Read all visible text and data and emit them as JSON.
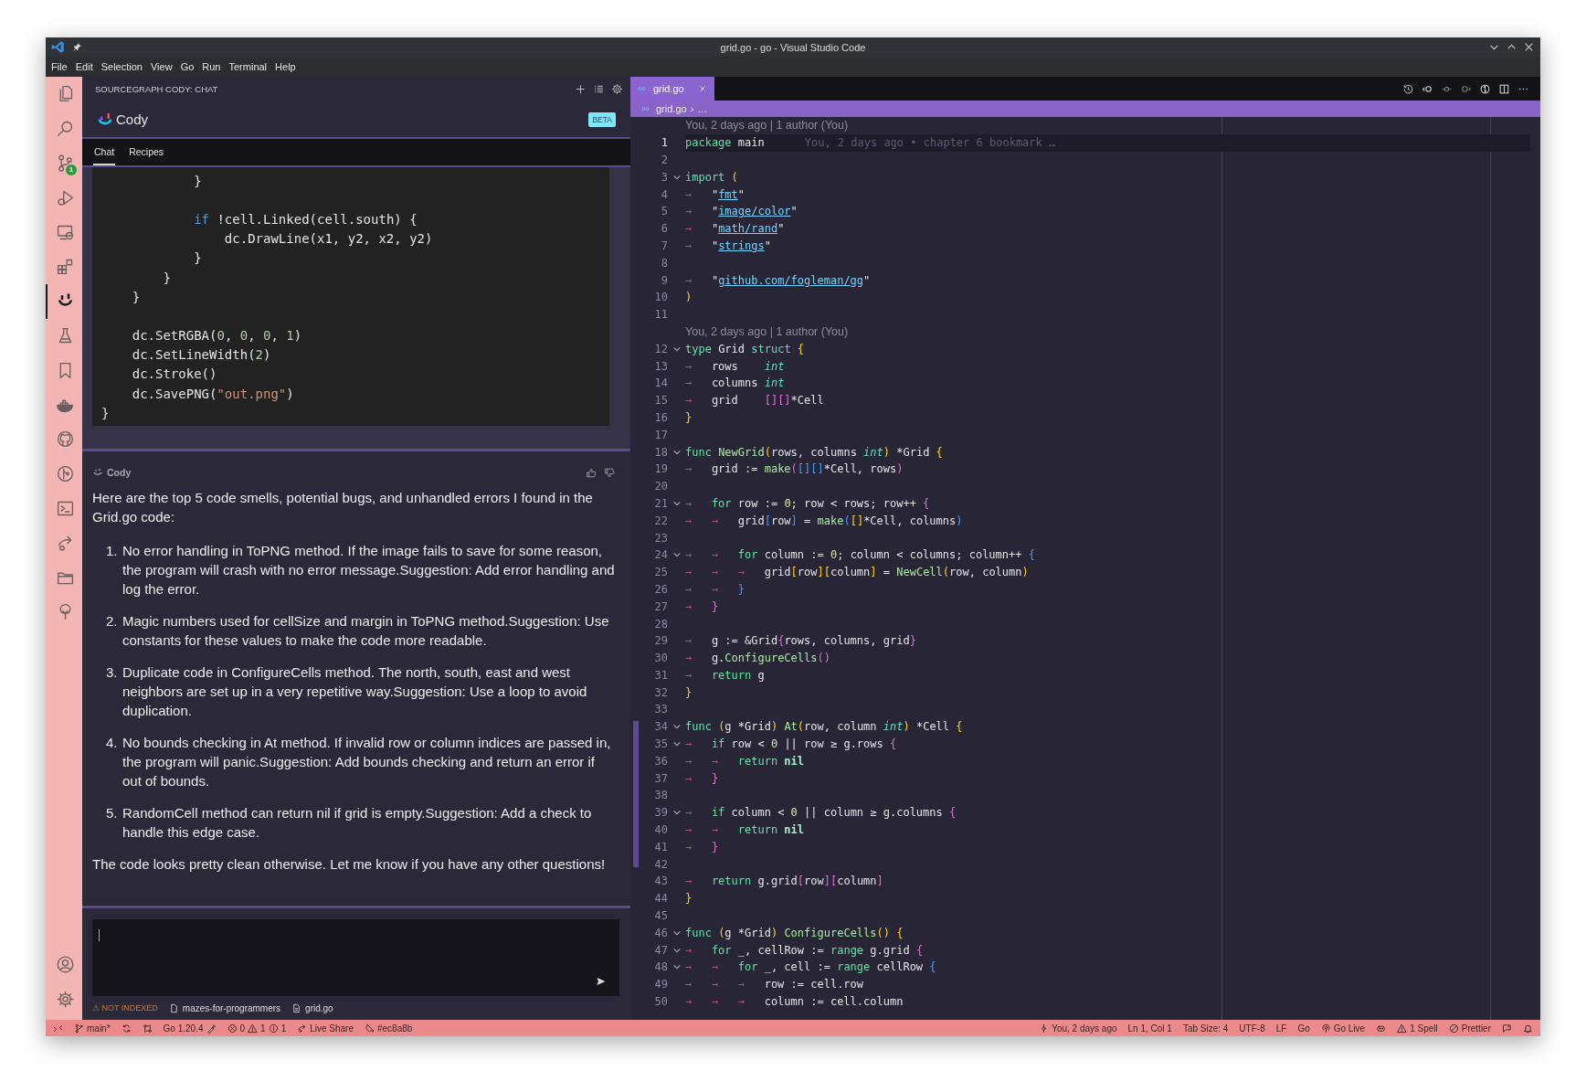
{
  "window": {
    "title": "grid.go - go - Visual Studio Code"
  },
  "menu": [
    "File",
    "Edit",
    "Selection",
    "View",
    "Go",
    "Run",
    "Terminal",
    "Help"
  ],
  "activity_bar": {
    "items": [
      {
        "kind": "files",
        "selected": false
      },
      {
        "kind": "search",
        "selected": false
      },
      {
        "kind": "source-control",
        "selected": false,
        "badge": "1"
      },
      {
        "kind": "run-debug",
        "selected": false
      },
      {
        "kind": "remote",
        "selected": false
      },
      {
        "kind": "extensions",
        "selected": false
      },
      {
        "kind": "cody",
        "selected": true
      },
      {
        "kind": "testing",
        "selected": false
      },
      {
        "kind": "bookmarks",
        "selected": false
      },
      {
        "kind": "docker",
        "selected": false
      },
      {
        "kind": "github",
        "selected": false
      },
      {
        "kind": "git-graph",
        "selected": false
      },
      {
        "kind": "terminal",
        "selected": false
      },
      {
        "kind": "live-share",
        "selected": false
      },
      {
        "kind": "folder",
        "selected": false
      },
      {
        "kind": "tree",
        "selected": false
      }
    ],
    "bottom": [
      {
        "kind": "account",
        "selected": false
      },
      {
        "kind": "settings",
        "selected": false
      }
    ]
  },
  "chat_panel": {
    "header": "SOURCEGRAPH CODY: CHAT",
    "title": "Cody",
    "badge": "BETA",
    "tabs": [
      {
        "label": "Chat",
        "selected": true
      },
      {
        "label": "Recipes",
        "selected": false
      }
    ],
    "code_block": [
      {
        "kind": "code",
        "tokens": [
          {
            "kind": "pl",
            "text": "            }"
          }
        ]
      },
      {
        "kind": "blank"
      },
      {
        "kind": "code",
        "tokens": [
          {
            "kind": "kw",
            "text": "            if"
          },
          {
            "kind": "pl",
            "text": " !cell.Linked(cell.south) {"
          }
        ]
      },
      {
        "kind": "code",
        "tokens": [
          {
            "kind": "pl",
            "text": "                dc.DrawLine(x1, y2, x2, y2)"
          }
        ]
      },
      {
        "kind": "code",
        "tokens": [
          {
            "kind": "pl",
            "text": "            }"
          }
        ]
      },
      {
        "kind": "code",
        "tokens": [
          {
            "kind": "pl",
            "text": "        }"
          }
        ]
      },
      {
        "kind": "code",
        "tokens": [
          {
            "kind": "pl",
            "text": "    }"
          }
        ]
      },
      {
        "kind": "blank"
      },
      {
        "kind": "code",
        "tokens": [
          {
            "kind": "pl",
            "text": "    dc.SetRGBA("
          },
          {
            "kind": "num",
            "text": "0"
          },
          {
            "kind": "pl",
            "text": ", "
          },
          {
            "kind": "num",
            "text": "0"
          },
          {
            "kind": "pl",
            "text": ", "
          },
          {
            "kind": "num",
            "text": "0"
          },
          {
            "kind": "pl",
            "text": ", "
          },
          {
            "kind": "num",
            "text": "1"
          },
          {
            "kind": "pl",
            "text": ")"
          }
        ]
      },
      {
        "kind": "code",
        "tokens": [
          {
            "kind": "pl",
            "text": "    dc.SetLineWidth("
          },
          {
            "kind": "num",
            "text": "2"
          },
          {
            "kind": "pl",
            "text": ")"
          }
        ]
      },
      {
        "kind": "code",
        "tokens": [
          {
            "kind": "pl",
            "text": "    dc.Stroke()"
          }
        ]
      },
      {
        "kind": "code",
        "tokens": [
          {
            "kind": "pl",
            "text": "    dc.SavePNG("
          },
          {
            "kind": "str",
            "text": "\"out.png\""
          },
          {
            "kind": "pl",
            "text": ")"
          }
        ]
      },
      {
        "kind": "code",
        "tokens": [
          {
            "kind": "pl",
            "text": "}"
          }
        ]
      }
    ],
    "message": {
      "author": "Cody",
      "intro": "Here are the top 5 code smells, potential bugs, and unhandled errors I found in the Grid.go code:",
      "items": [
        {
          "number": "1.",
          "text": "No error handling in ToPNG method. If the image fails to save for some reason, the program will crash with no error message.Suggestion: Add error handling and log the error."
        },
        {
          "number": "2.",
          "text": "Magic numbers used for cellSize and margin in ToPNG method.Suggestion: Use constants for these values to make the code more readable."
        },
        {
          "number": "3.",
          "text": "Duplicate code in ConfigureCells method. The north, south, east and west neighbors are set up in a very repetitive way.Suggestion: Use a loop to avoid duplication."
        },
        {
          "number": "4.",
          "text": "No bounds checking in At method. If invalid row or column indices are passed in, the program will panic.Suggestion: Add bounds checking and return an error if out of bounds."
        },
        {
          "number": "5.",
          "text": "RandomCell method can return nil if grid is empty.Suggestion: Add a check to handle this edge case."
        }
      ],
      "closing": "The code looks pretty clean otherwise. Let me know if you have any other questions!"
    },
    "footer": {
      "warning": "⚠ NOT INDEXED",
      "repo": "mazes-for-programmers",
      "file": "grid.go"
    }
  },
  "editor": {
    "tab": {
      "label": "grid.go",
      "selected": true
    },
    "breadcrumb": [
      "grid.go",
      "›",
      "…"
    ],
    "lines": [
      {
        "kind": "lens",
        "text": "You, 2 days ago | 1 author (You)"
      },
      {
        "kind": "code",
        "number": "1",
        "fold": false,
        "current": true,
        "tokens": [
          {
            "kind": "kw",
            "text": "package"
          },
          {
            "kind": "pl",
            "text": " main"
          }
        ],
        "blame": "You, 2 days ago • chapter 6 bookmark …"
      },
      {
        "kind": "code",
        "number": "2",
        "fold": false,
        "current": false
      },
      {
        "kind": "code",
        "number": "3",
        "fold": true,
        "current": false,
        "tokens": [
          {
            "kind": "kw",
            "text": "import"
          },
          {
            "kind": "b1",
            "text": " ("
          }
        ]
      },
      {
        "kind": "code",
        "number": "4",
        "fold": false,
        "current": false,
        "tokens": [
          {
            "kind": "tab",
            "text": "→"
          },
          {
            "kind": "q",
            "text": "\""
          },
          {
            "kind": "str",
            "text": "fmt"
          },
          {
            "kind": "q",
            "text": "\""
          }
        ]
      },
      {
        "kind": "code",
        "number": "5",
        "fold": false,
        "current": false,
        "tokens": [
          {
            "kind": "tab",
            "text": "→"
          },
          {
            "kind": "q",
            "text": "\""
          },
          {
            "kind": "str",
            "text": "image/color"
          },
          {
            "kind": "q",
            "text": "\""
          }
        ]
      },
      {
        "kind": "code",
        "number": "6",
        "fold": false,
        "current": false,
        "tokens": [
          {
            "kind": "tab",
            "text": "→"
          },
          {
            "kind": "q",
            "text": "\""
          },
          {
            "kind": "str",
            "text": "math/rand"
          },
          {
            "kind": "q",
            "text": "\""
          }
        ]
      },
      {
        "kind": "code",
        "number": "7",
        "fold": false,
        "current": false,
        "tokens": [
          {
            "kind": "tab",
            "text": "→"
          },
          {
            "kind": "q",
            "text": "\""
          },
          {
            "kind": "str",
            "text": "strings"
          },
          {
            "kind": "q",
            "text": "\""
          }
        ]
      },
      {
        "kind": "code",
        "number": "8",
        "fold": false,
        "current": false
      },
      {
        "kind": "code",
        "number": "9",
        "fold": false,
        "current": false,
        "tokens": [
          {
            "kind": "tab",
            "text": "→"
          },
          {
            "kind": "q",
            "text": "\""
          },
          {
            "kind": "str",
            "text": "github.com/fogleman/gg"
          },
          {
            "kind": "q",
            "text": "\""
          }
        ]
      },
      {
        "kind": "code",
        "number": "10",
        "fold": false,
        "current": false,
        "tokens": [
          {
            "kind": "b1",
            "text": ")"
          }
        ]
      },
      {
        "kind": "code",
        "number": "11",
        "fold": false,
        "current": false
      },
      {
        "kind": "lens",
        "text": "You, 2 days ago | 1 author (You)"
      },
      {
        "kind": "code",
        "number": "12",
        "fold": true,
        "current": false,
        "tokens": [
          {
            "kind": "kw",
            "text": "type"
          },
          {
            "kind": "pl",
            "text": " Grid "
          },
          {
            "kind": "kw",
            "text": "struct"
          },
          {
            "kind": "b1",
            "text": " {"
          }
        ]
      },
      {
        "kind": "code",
        "number": "13",
        "fold": false,
        "current": false,
        "tokens": [
          {
            "kind": "tab",
            "text": "→"
          },
          {
            "kind": "pl",
            "text": "rows    "
          },
          {
            "kind": "ty",
            "text": "int"
          }
        ]
      },
      {
        "kind": "code",
        "number": "14",
        "fold": false,
        "current": false,
        "tokens": [
          {
            "kind": "tab",
            "text": "→"
          },
          {
            "kind": "pl",
            "text": "columns "
          },
          {
            "kind": "ty",
            "text": "int"
          }
        ]
      },
      {
        "kind": "code",
        "number": "15",
        "fold": false,
        "current": false,
        "tokens": [
          {
            "kind": "tab",
            "text": "→"
          },
          {
            "kind": "pl",
            "text": "grid    "
          },
          {
            "kind": "b2",
            "text": "[][]"
          },
          {
            "kind": "pl",
            "text": "*Cell"
          }
        ]
      },
      {
        "kind": "code",
        "number": "16",
        "fold": false,
        "current": false,
        "tokens": [
          {
            "kind": "b1",
            "text": "}"
          }
        ]
      },
      {
        "kind": "code",
        "number": "17",
        "fold": false,
        "current": false
      },
      {
        "kind": "code",
        "number": "18",
        "fold": true,
        "current": false,
        "tokens": [
          {
            "kind": "kw",
            "text": "func "
          },
          {
            "kind": "fn",
            "text": "NewGrid"
          },
          {
            "kind": "b1",
            "text": "("
          },
          {
            "kind": "pl",
            "text": "rows, columns "
          },
          {
            "kind": "ty",
            "text": "int"
          },
          {
            "kind": "b1",
            "text": ")"
          },
          {
            "kind": "pl",
            "text": " *Grid "
          },
          {
            "kind": "b1",
            "text": "{"
          }
        ]
      },
      {
        "kind": "code",
        "number": "19",
        "fold": false,
        "current": false,
        "tokens": [
          {
            "kind": "tab",
            "text": "→"
          },
          {
            "kind": "pl",
            "text": "grid := "
          },
          {
            "kind": "fn",
            "text": "make"
          },
          {
            "kind": "b2",
            "text": "("
          },
          {
            "kind": "b3",
            "text": "[][]"
          },
          {
            "kind": "pl",
            "text": "*Cell, rows"
          },
          {
            "kind": "b2",
            "text": ")"
          }
        ]
      },
      {
        "kind": "code",
        "number": "20",
        "fold": false,
        "current": false
      },
      {
        "kind": "code",
        "number": "21",
        "fold": true,
        "current": false,
        "tokens": [
          {
            "kind": "tab",
            "text": "→"
          },
          {
            "kind": "kw",
            "text": "for"
          },
          {
            "kind": "pl",
            "text": " row := "
          },
          {
            "kind": "num",
            "text": "0"
          },
          {
            "kind": "pl",
            "text": "; row < rows; row++ "
          },
          {
            "kind": "b2",
            "text": "{"
          }
        ]
      },
      {
        "kind": "code",
        "number": "22",
        "fold": false,
        "current": false,
        "tokens": [
          {
            "kind": "tab",
            "text": "→"
          },
          {
            "kind": "tab",
            "text": "→"
          },
          {
            "kind": "pl",
            "text": "grid"
          },
          {
            "kind": "b3",
            "text": "["
          },
          {
            "kind": "pl",
            "text": "row"
          },
          {
            "kind": "b3",
            "text": "]"
          },
          {
            "kind": "pl",
            "text": " = "
          },
          {
            "kind": "fn",
            "text": "make"
          },
          {
            "kind": "b3",
            "text": "("
          },
          {
            "kind": "b1",
            "text": "[]"
          },
          {
            "kind": "pl",
            "text": "*Cell, columns"
          },
          {
            "kind": "b3",
            "text": ")"
          }
        ]
      },
      {
        "kind": "code",
        "number": "23",
        "fold": false,
        "current": false
      },
      {
        "kind": "code",
        "number": "24",
        "fold": true,
        "current": false,
        "tokens": [
          {
            "kind": "tab",
            "text": "→"
          },
          {
            "kind": "tab",
            "text": "→"
          },
          {
            "kind": "kw",
            "text": "for"
          },
          {
            "kind": "pl",
            "text": " column := "
          },
          {
            "kind": "num",
            "text": "0"
          },
          {
            "kind": "pl",
            "text": "; column < columns; column++ "
          },
          {
            "kind": "b3",
            "text": "{"
          }
        ]
      },
      {
        "kind": "code",
        "number": "25",
        "fold": false,
        "current": false,
        "tokens": [
          {
            "kind": "tab",
            "text": "→"
          },
          {
            "kind": "tab",
            "text": "→"
          },
          {
            "kind": "tab",
            "text": "→"
          },
          {
            "kind": "pl",
            "text": "grid"
          },
          {
            "kind": "b1",
            "text": "["
          },
          {
            "kind": "pl",
            "text": "row"
          },
          {
            "kind": "b1",
            "text": "]["
          },
          {
            "kind": "pl",
            "text": "column"
          },
          {
            "kind": "b1",
            "text": "]"
          },
          {
            "kind": "pl",
            "text": " = "
          },
          {
            "kind": "fn",
            "text": "NewCell"
          },
          {
            "kind": "b1",
            "text": "("
          },
          {
            "kind": "pl",
            "text": "row, column"
          },
          {
            "kind": "b1",
            "text": ")"
          }
        ]
      },
      {
        "kind": "code",
        "number": "26",
        "fold": false,
        "current": false,
        "tokens": [
          {
            "kind": "tab",
            "text": "→"
          },
          {
            "kind": "tab",
            "text": "→"
          },
          {
            "kind": "b3",
            "text": "}"
          }
        ]
      },
      {
        "kind": "code",
        "number": "27",
        "fold": false,
        "current": false,
        "tokens": [
          {
            "kind": "tab",
            "text": "→"
          },
          {
            "kind": "b2",
            "text": "}"
          }
        ]
      },
      {
        "kind": "code",
        "number": "28",
        "fold": false,
        "current": false
      },
      {
        "kind": "code",
        "number": "29",
        "fold": false,
        "current": false,
        "tokens": [
          {
            "kind": "tab",
            "text": "→"
          },
          {
            "kind": "pl",
            "text": "g := &Grid"
          },
          {
            "kind": "b2",
            "text": "{"
          },
          {
            "kind": "pl",
            "text": "rows, columns, grid"
          },
          {
            "kind": "b2",
            "text": "}"
          }
        ]
      },
      {
        "kind": "code",
        "number": "30",
        "fold": false,
        "current": false,
        "tokens": [
          {
            "kind": "tab",
            "text": "→"
          },
          {
            "kind": "pl",
            "text": "g."
          },
          {
            "kind": "fn",
            "text": "ConfigureCells"
          },
          {
            "kind": "b2",
            "text": "()"
          }
        ]
      },
      {
        "kind": "code",
        "number": "31",
        "fold": false,
        "current": false,
        "tokens": [
          {
            "kind": "tab",
            "text": "→"
          },
          {
            "kind": "kw",
            "text": "return"
          },
          {
            "kind": "pl",
            "text": " g"
          }
        ]
      },
      {
        "kind": "code",
        "number": "32",
        "fold": false,
        "current": false,
        "tokens": [
          {
            "kind": "b1",
            "text": "}"
          }
        ]
      },
      {
        "kind": "code",
        "number": "33",
        "fold": false,
        "current": false
      },
      {
        "kind": "code",
        "number": "34",
        "fold": true,
        "current": false,
        "tokens": [
          {
            "kind": "kw",
            "text": "func"
          },
          {
            "kind": "b1",
            "text": " ("
          },
          {
            "kind": "pl",
            "text": "g *Grid"
          },
          {
            "kind": "b1",
            "text": ")"
          },
          {
            "kind": "fn",
            "text": " At"
          },
          {
            "kind": "b1",
            "text": "("
          },
          {
            "kind": "pl",
            "text": "row, column "
          },
          {
            "kind": "ty",
            "text": "int"
          },
          {
            "kind": "b1",
            "text": ")"
          },
          {
            "kind": "pl",
            "text": " *Cell "
          },
          {
            "kind": "b1",
            "text": "{"
          }
        ]
      },
      {
        "kind": "code",
        "number": "35",
        "fold": true,
        "current": false,
        "tokens": [
          {
            "kind": "tab",
            "text": "→"
          },
          {
            "kind": "kw",
            "text": "if"
          },
          {
            "kind": "pl",
            "text": " row < "
          },
          {
            "kind": "num",
            "text": "0"
          },
          {
            "kind": "pl",
            "text": " || row ≥ g.rows "
          },
          {
            "kind": "b2",
            "text": "{"
          }
        ]
      },
      {
        "kind": "code",
        "number": "36",
        "fold": false,
        "current": false,
        "tokens": [
          {
            "kind": "tab",
            "text": "→"
          },
          {
            "kind": "tab",
            "text": "→"
          },
          {
            "kind": "kw",
            "text": "return"
          },
          {
            "kind": "nil",
            "text": " nil"
          }
        ]
      },
      {
        "kind": "code",
        "number": "37",
        "fold": false,
        "current": false,
        "tokens": [
          {
            "kind": "tab",
            "text": "→"
          },
          {
            "kind": "b2",
            "text": "}"
          }
        ]
      },
      {
        "kind": "code",
        "number": "38",
        "fold": false,
        "current": false
      },
      {
        "kind": "code",
        "number": "39",
        "fold": true,
        "current": false,
        "tokens": [
          {
            "kind": "tab",
            "text": "→"
          },
          {
            "kind": "kw",
            "text": "if"
          },
          {
            "kind": "pl",
            "text": " column < "
          },
          {
            "kind": "num",
            "text": "0"
          },
          {
            "kind": "pl",
            "text": " || column ≥ g.columns "
          },
          {
            "kind": "b2",
            "text": "{"
          }
        ]
      },
      {
        "kind": "code",
        "number": "40",
        "fold": false,
        "current": false,
        "tokens": [
          {
            "kind": "tab",
            "text": "→"
          },
          {
            "kind": "tab",
            "text": "→"
          },
          {
            "kind": "kw",
            "text": "return"
          },
          {
            "kind": "nil",
            "text": " nil"
          }
        ]
      },
      {
        "kind": "code",
        "number": "41",
        "fold": false,
        "current": false,
        "tokens": [
          {
            "kind": "tab",
            "text": "→"
          },
          {
            "kind": "b2",
            "text": "}"
          }
        ]
      },
      {
        "kind": "code",
        "number": "42",
        "fold": false,
        "current": false
      },
      {
        "kind": "code",
        "number": "43",
        "fold": false,
        "current": false,
        "tokens": [
          {
            "kind": "tab",
            "text": "→"
          },
          {
            "kind": "kw",
            "text": "return"
          },
          {
            "kind": "pl",
            "text": " g.grid"
          },
          {
            "kind": "b2",
            "text": "["
          },
          {
            "kind": "pl",
            "text": "row"
          },
          {
            "kind": "b2",
            "text": "]["
          },
          {
            "kind": "pl",
            "text": "column"
          },
          {
            "kind": "b2",
            "text": "]"
          }
        ]
      },
      {
        "kind": "code",
        "number": "44",
        "fold": false,
        "current": false,
        "tokens": [
          {
            "kind": "b1",
            "text": "}"
          }
        ]
      },
      {
        "kind": "code",
        "number": "45",
        "fold": false,
        "current": false
      },
      {
        "kind": "code",
        "number": "46",
        "fold": true,
        "current": false,
        "tokens": [
          {
            "kind": "kw",
            "text": "func"
          },
          {
            "kind": "b1",
            "text": " ("
          },
          {
            "kind": "pl",
            "text": "g *Grid"
          },
          {
            "kind": "b1",
            "text": ")"
          },
          {
            "kind": "fn",
            "text": " ConfigureCells"
          },
          {
            "kind": "b1",
            "text": "()"
          },
          {
            "kind": "b1",
            "text": " {"
          }
        ]
      },
      {
        "kind": "code",
        "number": "47",
        "fold": true,
        "current": false,
        "tokens": [
          {
            "kind": "tab",
            "text": "→"
          },
          {
            "kind": "kw",
            "text": "for"
          },
          {
            "kind": "pl",
            "text": " _, cellRow := "
          },
          {
            "kind": "kw",
            "text": "range"
          },
          {
            "kind": "pl",
            "text": " g.grid "
          },
          {
            "kind": "b2",
            "text": "{"
          }
        ]
      },
      {
        "kind": "code",
        "number": "48",
        "fold": true,
        "current": false,
        "tokens": [
          {
            "kind": "tab",
            "text": "→"
          },
          {
            "kind": "tab",
            "text": "→"
          },
          {
            "kind": "kw",
            "text": "for"
          },
          {
            "kind": "pl",
            "text": " _, cell := "
          },
          {
            "kind": "kw",
            "text": "range"
          },
          {
            "kind": "pl",
            "text": " cellRow "
          },
          {
            "kind": "b3",
            "text": "{"
          }
        ]
      },
      {
        "kind": "code",
        "number": "49",
        "fold": false,
        "current": false,
        "tokens": [
          {
            "kind": "tab",
            "text": "→"
          },
          {
            "kind": "tab",
            "text": "→"
          },
          {
            "kind": "tab",
            "text": "→"
          },
          {
            "kind": "pl",
            "text": "row := cell.row"
          }
        ]
      },
      {
        "kind": "code",
        "number": "50",
        "fold": false,
        "current": false,
        "tokens": [
          {
            "kind": "tab",
            "text": "→"
          },
          {
            "kind": "tab",
            "text": "→"
          },
          {
            "kind": "tab",
            "text": "→"
          },
          {
            "kind": "pl",
            "text": "column := cell.column"
          }
        ]
      }
    ]
  },
  "status_bar": {
    "left": [
      {
        "kind": "remote"
      },
      {
        "kind": "branch",
        "text": "main*"
      },
      {
        "kind": "sync"
      },
      {
        "kind": "compare"
      },
      {
        "kind": "go",
        "text": "Go 1.20.4"
      },
      {
        "kind": "problems",
        "errors": "0",
        "warnings": "1",
        "infos": "1"
      },
      {
        "kind": "live-share",
        "text": "Live Share"
      },
      {
        "kind": "color",
        "text": "#ec8a8b"
      }
    ],
    "right": [
      {
        "kind": "blame",
        "text": "You, 2 days ago"
      },
      {
        "kind": "text",
        "text": "Ln 1, Col 1"
      },
      {
        "kind": "text",
        "text": "Tab Size: 4"
      },
      {
        "kind": "text",
        "text": "UTF-8"
      },
      {
        "kind": "text",
        "text": "LF"
      },
      {
        "kind": "text",
        "text": "Go"
      },
      {
        "kind": "go-live",
        "text": "Go Live"
      },
      {
        "kind": "copilot"
      },
      {
        "kind": "spell",
        "text": "1 Spell"
      },
      {
        "kind": "prettier",
        "text": "Prettier"
      },
      {
        "kind": "feedback"
      },
      {
        "kind": "bell"
      }
    ]
  }
}
